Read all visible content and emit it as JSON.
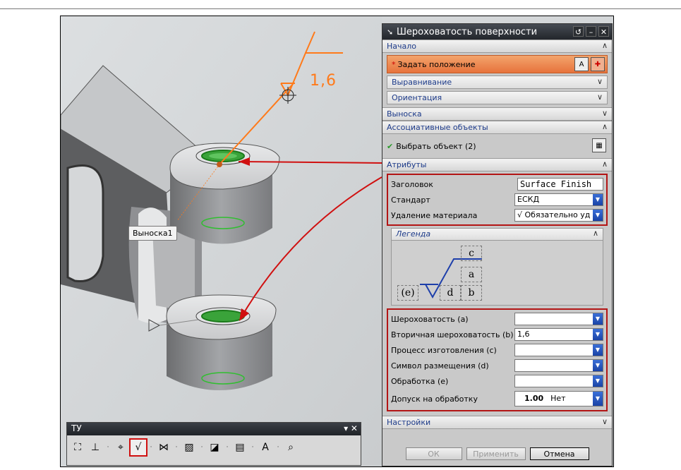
{
  "viewport": {
    "callout_label": "Выноска1",
    "roughness_value": "1,6"
  },
  "toolbar": {
    "title": "ТУ",
    "controls": "▾ ✕"
  },
  "dialog": {
    "title": "Шероховатость поверхности",
    "sections": {
      "start": "Начало",
      "set_position": "Задать положение",
      "alignment": "Выравнивание",
      "orientation": "Ориентация",
      "leader": "Выноска",
      "associative": "Ассоциативные объекты",
      "select_object": "Выбрать объект (2)",
      "attributes": "Атрибуты",
      "legend": "Легенда",
      "settings": "Настройки"
    },
    "attributes": {
      "heading_label": "Заголовок",
      "heading_value": "Surface Finish",
      "standard_label": "Стандарт",
      "standard_value": "ЕСКД",
      "material_removal_label": "Удаление материала",
      "material_removal_value": "Обязательно уд"
    },
    "legend": {
      "c": "c",
      "a": "a",
      "e": "(e)",
      "d": "d",
      "b": "b"
    },
    "params": {
      "roughness_label": "Шероховатость (a)",
      "roughness_value": "",
      "secondary_label": "Вторичная шероховатость (b)",
      "secondary_value": "1,6",
      "process_label": "Процесс изготовления (c)",
      "process_value": "",
      "lay_label": "Символ размещения (d)",
      "lay_value": "",
      "machining_label": "Обработка (e)",
      "machining_value": "",
      "allowance_label": "Допуск на обработку",
      "allowance_number": "1.00",
      "allowance_value": "Нет"
    },
    "buttons": {
      "ok": "ОК",
      "apply": "Применить",
      "cancel": "Отмена"
    }
  }
}
